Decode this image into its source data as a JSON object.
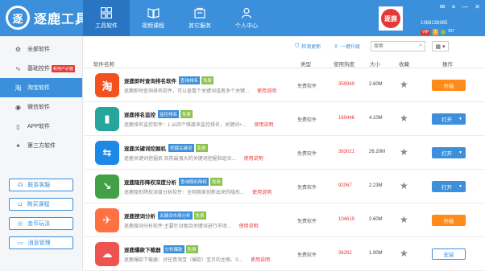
{
  "app": {
    "logo_char": "逐",
    "title": "逐鹿工具箱"
  },
  "nav": [
    {
      "label": "工具软件",
      "icon": "grid-icon",
      "active": true
    },
    {
      "label": "视频课程",
      "icon": "book-icon",
      "active": false
    },
    {
      "label": "其它服务",
      "icon": "cart-icon",
      "active": false
    },
    {
      "label": "个人中心",
      "icon": "user-icon",
      "active": false
    }
  ],
  "user": {
    "avatar_text": "逐鹿",
    "id": "1368138365",
    "vip": "VIP",
    "level": "1",
    "points": "397"
  },
  "window_controls": {
    "skin": "✉",
    "menu": "≡",
    "minimize": "—",
    "close": "✕"
  },
  "sidebar": {
    "items": [
      {
        "label": "全部软件",
        "icon": "gears-icon",
        "glyph": "⚙",
        "active": false
      },
      {
        "label": "基础控件",
        "icon": "chart-line-icon",
        "glyph": "∿",
        "active": false,
        "tag": "新用户必装"
      },
      {
        "label": "淘宝软件",
        "icon": "taobao-icon",
        "glyph": "淘",
        "active": true
      },
      {
        "label": "微信软件",
        "icon": "wechat-icon",
        "glyph": "◉",
        "active": false
      },
      {
        "label": "APP软件",
        "icon": "phone-icon",
        "glyph": "▯",
        "active": false
      },
      {
        "label": "第三方软件",
        "icon": "puzzle-icon",
        "glyph": "✦",
        "active": false
      }
    ],
    "buttons": [
      {
        "label": "联系客服",
        "icon": "headset-icon",
        "glyph": "☊"
      },
      {
        "label": "购买课程",
        "icon": "cart-small-icon",
        "glyph": "⊔"
      },
      {
        "label": "金币玩法",
        "icon": "coin-icon",
        "glyph": "◎"
      },
      {
        "label": "消息管理",
        "icon": "message-icon",
        "glyph": "▭"
      }
    ]
  },
  "toolbar": {
    "check_update": "检测更新",
    "upgrade_all": "一键升级",
    "search_placeholder": "搜索",
    "view_glyph": "▦ ▾"
  },
  "table": {
    "headers": {
      "name": "软件名称",
      "type": "类型",
      "hot": "使用热度",
      "size": "大小",
      "fav": "收藏",
      "action": "操作"
    },
    "help_label": "使用说明",
    "rows": [
      {
        "icon_char": "淘",
        "icon_color": "#f4511e",
        "name": "逐鹿即时查询排名软件",
        "tag1": "查询排名",
        "tag2": "免费",
        "desc": "逐鹿即时查询排名软件，可以查看个关键词或者多个关键...",
        "type": "免费软件",
        "hot": "359969",
        "size": "2.60M",
        "action": "升级",
        "action_kind": "upgrade"
      },
      {
        "icon_char": "▮",
        "icon_color": "#26a69a",
        "name": "逐鹿排名监控",
        "tag1": "监控排名",
        "tag2": "免费",
        "desc": "逐鹿排名监控软件：1.从四个维度来监控排名，关键词+...",
        "type": "免费软件",
        "hot": "169446",
        "size": "4.10M",
        "action": "打开",
        "action_kind": "open"
      },
      {
        "icon_char": "⇆",
        "icon_color": "#1e88e5",
        "name": "逐鹿关键词挖掘机",
        "tag1": "挖掘关键词",
        "tag2": "免费",
        "desc": "逐鹿关键词挖掘机 目前最强大的关键词挖掘和组合...",
        "type": "免费软件",
        "hot": "363021",
        "size": "26.20M",
        "action": "打开",
        "action_kind": "open"
      },
      {
        "icon_char": "↘",
        "icon_color": "#43a047",
        "name": "逐鹿隐形降权深度分析",
        "tag1": "查询隐形降权",
        "tag2": "免费",
        "desc": "逐鹿隐形降权深度分析软件：全网首家创新出来的隐形...",
        "type": "免费软件",
        "hot": "92067",
        "size": "2.23M",
        "action": "打开",
        "action_kind": "open"
      },
      {
        "icon_char": "✈",
        "icon_color": "#ff7043",
        "name": "逐鹿搜词分析",
        "tag1": "关键词市场分析",
        "tag2": "免费",
        "desc": "逐鹿搜词分析软件:主要针对类目关键词进行市场...",
        "type": "免费软件",
        "hot": "104619",
        "size": "2.60M",
        "action": "升级",
        "action_kind": "upgrade"
      },
      {
        "icon_char": "☁",
        "icon_color": "#ef5350",
        "name": "逐鹿爆款下载器",
        "tag1": "分析爆款",
        "tag2": "免费",
        "desc": "逐鹿爆款下载器：对任意淘宝（爆款）宝贝的主图、S...",
        "type": "免费软件",
        "hot": "36262",
        "size": "1.90M",
        "action": "安装",
        "action_kind": "install"
      }
    ]
  }
}
